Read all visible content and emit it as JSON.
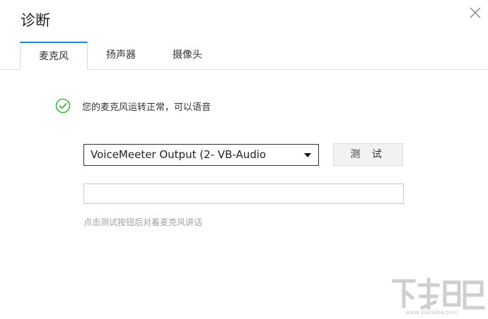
{
  "dialog": {
    "title": "诊断",
    "close_icon": "close-icon"
  },
  "tabs": [
    {
      "label": "麦克风",
      "active": true
    },
    {
      "label": "扬声器",
      "active": false
    },
    {
      "label": "摄像头",
      "active": false
    }
  ],
  "status": {
    "icon": "check-circle-icon",
    "icon_color": "#3cb04a",
    "text": "您的麦克风运转正常，可以语音"
  },
  "device_select": {
    "value": "VoiceMeeter Output (2- VB-Audio"
  },
  "test_button": {
    "label": "测 试"
  },
  "hint": {
    "text": "点击测试按钮后对着麦克风讲话"
  },
  "watermark": {
    "url": "www.xiazaiba.com"
  },
  "colors": {
    "accent": "#2c7be5",
    "success": "#3cb04a",
    "hint": "#a0a0a0"
  }
}
